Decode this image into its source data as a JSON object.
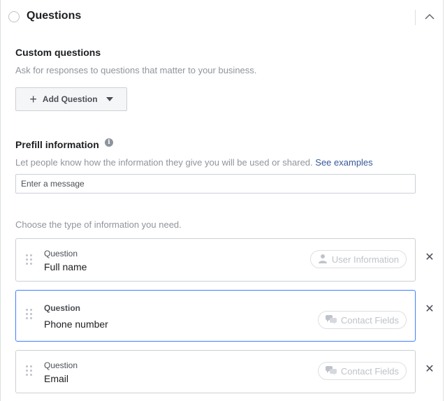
{
  "section": {
    "title": "Questions"
  },
  "custom_questions": {
    "heading": "Custom questions",
    "description": "Ask for responses to questions that matter to your business.",
    "add_button_label": "Add Question"
  },
  "prefill": {
    "heading": "Prefill information",
    "info_icon_glyph": "i",
    "description": "Let people know how the information they give you will be used or shared.",
    "link_label": "See examples",
    "message_placeholder": "Enter a message"
  },
  "info_types": {
    "prompt": "Choose the type of information you need.",
    "questions": [
      {
        "label": "Question",
        "value": "Full name",
        "category": "User Information",
        "category_icon": "user-icon",
        "active": false
      },
      {
        "label": "Question",
        "value": "Phone number",
        "category": "Contact Fields",
        "category_icon": "chat-bubbles-icon",
        "active": true
      },
      {
        "label": "Question",
        "value": "Email",
        "category": "Contact Fields",
        "category_icon": "chat-bubbles-icon",
        "active": false
      }
    ],
    "remove_glyph": "✕"
  },
  "colors": {
    "link": "#365899",
    "active_border": "#4080ff",
    "muted_text": "#90949c"
  }
}
